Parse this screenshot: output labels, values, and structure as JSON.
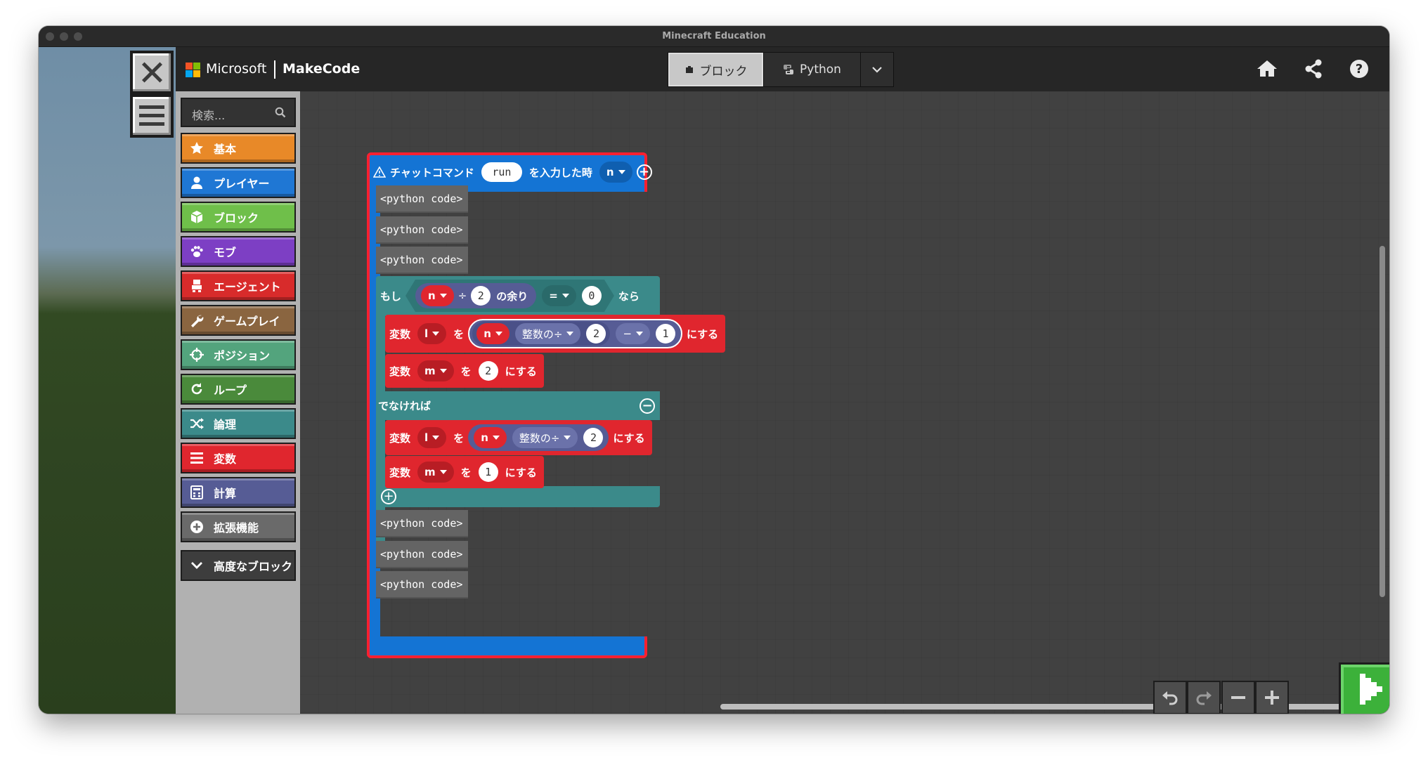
{
  "window": {
    "title": "Minecraft Education"
  },
  "header": {
    "microsoft_label": "Microsoft",
    "app_label": "MakeCode",
    "mode_toggle": {
      "blocks_label": "ブロック",
      "python_label": "Python",
      "selected": "blocks"
    },
    "icons": [
      "home-icon",
      "share-icon",
      "help-icon",
      "settings-icon"
    ]
  },
  "toolbox": {
    "search_placeholder": "検索...",
    "categories": [
      {
        "label": "基本",
        "color": "#e88928",
        "icon": "star-icon"
      },
      {
        "label": "プレイヤー",
        "color": "#1f77d4",
        "icon": "person-icon"
      },
      {
        "label": "ブロック",
        "color": "#6fbf4a",
        "icon": "cube-icon"
      },
      {
        "label": "モブ",
        "color": "#7d3fc4",
        "icon": "paw-icon"
      },
      {
        "label": "エージェント",
        "color": "#d82b2b",
        "icon": "agent-icon"
      },
      {
        "label": "ゲームプレイ",
        "color": "#8a6540",
        "icon": "wrench-icon"
      },
      {
        "label": "ポジション",
        "color": "#53a47d",
        "icon": "crosshair-icon"
      },
      {
        "label": "ループ",
        "color": "#4a8a3b",
        "icon": "loop-icon"
      },
      {
        "label": "論理",
        "color": "#3b8a8a",
        "icon": "shuffle-icon"
      },
      {
        "label": "変数",
        "color": "#e0262e",
        "icon": "list-icon"
      },
      {
        "label": "計算",
        "color": "#565c95",
        "icon": "calculator-icon"
      },
      {
        "label": "拡張機能",
        "color": "#6a6a6a",
        "icon": "plus-circle-icon"
      }
    ],
    "advanced_label": "高度なブロック"
  },
  "workspace": {
    "event_block": {
      "label_prefix": "チャットコマンド",
      "command": "run",
      "label_suffix": "を入力した時",
      "param": "n"
    },
    "python_code_label": "<python code>",
    "if_block": {
      "if_label": "もし",
      "var_n": "n",
      "div_sign": "÷",
      "divisor": "2",
      "remainder_label": "の余り",
      "compare_op": "=",
      "compare_value": "0",
      "then_label": "なら",
      "else_label": "でなければ"
    },
    "set_var_label": "変数",
    "to_label": "を",
    "set_suffix": "にする",
    "then_set_l": {
      "var": "l",
      "value_var": "n",
      "func": "整数の÷",
      "func_arg": "2",
      "op": "−",
      "op_arg": "1"
    },
    "then_set_m": {
      "var": "m",
      "value": "2"
    },
    "else_set_l": {
      "var": "l",
      "value_var": "n",
      "func": "整数の÷",
      "func_arg": "2"
    },
    "else_set_m": {
      "var": "m",
      "value": "1"
    }
  },
  "colors": {
    "event_block": "#1474d4",
    "highlight_border": "#ff2030",
    "logic_block": "#3b8a8a",
    "variable_block": "#e0262e",
    "math_block": "#565c95",
    "python_block": "#646464",
    "play_button": "#3cb13a"
  }
}
